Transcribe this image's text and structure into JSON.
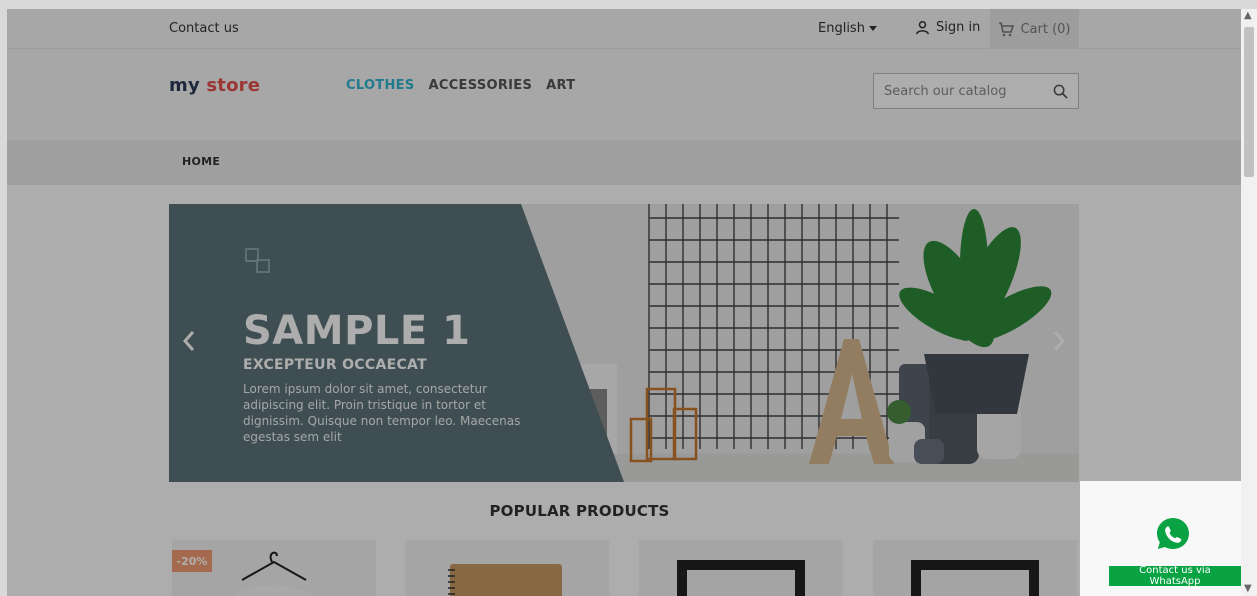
{
  "header": {
    "contact_label": "Contact us",
    "language": "English",
    "signin_label": "Sign in",
    "cart_label": "Cart (0)"
  },
  "logo": {
    "part1": "my",
    "part2": "store"
  },
  "nav": {
    "items": [
      {
        "label": "CLOTHES"
      },
      {
        "label": "ACCESSORIES"
      },
      {
        "label": "ART"
      }
    ]
  },
  "search": {
    "placeholder": "Search our catalog"
  },
  "breadcrumb": {
    "home": "HOME"
  },
  "hero": {
    "title": "SAMPLE 1",
    "subtitle": "EXCEPTEUR OCCAECAT",
    "text": "Lorem ipsum dolor sit amet, consectetur adipiscing elit. Proin tristique in tortor et dignissim. Quisque non tempor leo. Maecenas egestas sem elit"
  },
  "popular": {
    "title": "POPULAR PRODUCTS"
  },
  "products": [
    {
      "badge": "-20%"
    },
    {
      "badge": ""
    },
    {
      "badge": ""
    },
    {
      "badge": ""
    }
  ],
  "whatsapp": {
    "button_label": "Contact us via WhatsApp"
  },
  "colors": {
    "accent": "#2fb5d2",
    "whatsapp_green": "#0aa344",
    "badge": "#f39d72",
    "hero_panel": "#5c7479"
  },
  "icons": [
    "user-icon",
    "cart-icon",
    "search-icon",
    "chevron-left-icon",
    "chevron-right-icon",
    "whatsapp-icon",
    "caret-down-icon"
  ]
}
